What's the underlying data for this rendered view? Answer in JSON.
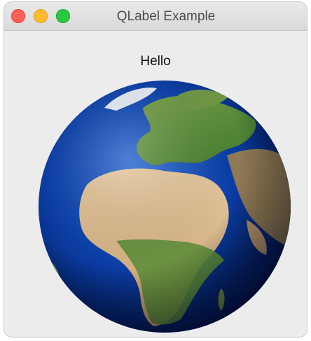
{
  "window": {
    "title": "QLabel Example"
  },
  "label": {
    "text": "Hello"
  },
  "image": {
    "icon": "earth-globe-image",
    "colors": {
      "ocean": "#0b3fa8",
      "land_desert": "#d9b88a",
      "land_green": "#5e8e3a"
    }
  },
  "colors": {
    "close": "#fe5f57",
    "minimize": "#febc2e",
    "zoom": "#28c840"
  }
}
